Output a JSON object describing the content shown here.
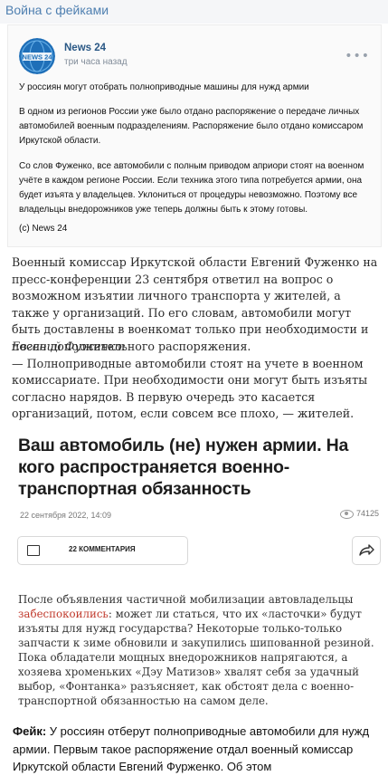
{
  "header": {
    "title": "Война с фейками"
  },
  "post": {
    "author": "News 24",
    "time": "три часа назад",
    "paragraphs": [
      "У россиян могут отобрать полноприводные машины для нужд армии",
      "В одном из регионов России уже было отдано распоряжение о передаче личных автомобилей военным подразделениям. Распоряжение было отдано комиссаром Иркутской области.",
      "Со слов Фуженко, все автомобили с полным приводом априори стоят на военном учёте в каждом регионе России. Если техника этого типа потребуется армии, она будет изъята у владельцев. Уклониться от процедуры невозможно. Поэтому все владельцы внедорожников уже теперь должны быть к этому готовы.",
      "(с) News 24"
    ]
  },
  "body": {
    "paragraph1": "Военный комиссар Иркутской области Евгений Фуженко на пресс-конференции 23 сентября ответил на вопрос о возможном изъятии личного транспорта у жителей, а также у организаций. По его словам, автомобили могут быть доставлены в военкомат только при необходимости и после дополнительного распоряжения.",
    "quote_author": "Евгений Фуженко:",
    "quote": "— Полноприводные автомобили стоят на учете в военном комиссариате. При необходимости они могут быть изъяты согласно нарядов. В первую очередь это касается организаций, потом, если совсем все плохо, — жителей."
  },
  "article": {
    "title": "Ваш автомобиль (не) нужен армии. На кого распространяется военно-транспортная обязанность",
    "date": "22 сентября 2022, 14:09",
    "views": "74125",
    "comments_label": "22 КОММЕНТАРИЯ",
    "body_before": "После объявления частичной мобилизации автовладельцы ",
    "body_highlight": "забеспокоились",
    "body_after": ": может ли статься, что их «ласточки» будут изъяты для нужд государства? Некоторые только-только запчасти к зиме обновили и закупились шипованной резиной. Пока обладатели мощных внедорожников напрягаются, а хозяева хроменьких «Дэу Матизов» хвалят себя за удачный выбор, «Фонтанка» разъясняет, как обстоят дела с военно-транспортной обязанностью на самом деле."
  },
  "fact": {
    "label": "Фейк:",
    "text": " У россиян отберут полноприводные автомобили для нужд армии. Первым такое распоряжение отдал военный комиссар Иркутской области Евгений Фурженко. Об этом"
  },
  "colors": {
    "link": "#2a5885",
    "header": "#4e7fb0",
    "highlight": "#c0392b"
  }
}
